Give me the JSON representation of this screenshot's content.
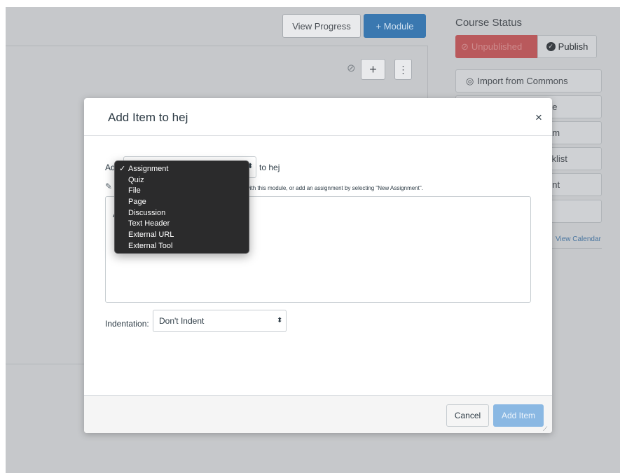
{
  "header": {
    "view_progress_label": "View Progress",
    "add_module_label": "+ Module"
  },
  "course_status": {
    "title": "Course Status",
    "unpublished_label": "Unpublished",
    "publish_label": "Publish"
  },
  "sidebar": {
    "import_label": "Import from Commons",
    "partial_items": [
      "ge",
      "am",
      "cklist",
      "ent",
      ""
    ],
    "calendar_link": "View Calendar"
  },
  "modal": {
    "title": "Add Item to hej",
    "close_glyph": "×",
    "add_prefix": "Ad",
    "to_module": "to hej",
    "hint_text": "with this module, or add an assignment by selecting \"New Assignment\".",
    "list_partial_a": "A",
    "indentation_label": "Indentation:",
    "indentation_value": "Don't Indent",
    "cancel_label": "Cancel",
    "add_item_label": "Add Item"
  },
  "item_type_dropdown": {
    "selected": "Assignment",
    "options": [
      "Assignment",
      "Quiz",
      "File",
      "Page",
      "Discussion",
      "Text Header",
      "External URL",
      "External Tool"
    ]
  },
  "colors": {
    "overlay": "#c6c8cb",
    "primary": "#3a78b0",
    "add_item_disabled": "#8ab8e3",
    "unpublished": "#b9595c",
    "dropdown_bg": "#2b2b2c"
  }
}
